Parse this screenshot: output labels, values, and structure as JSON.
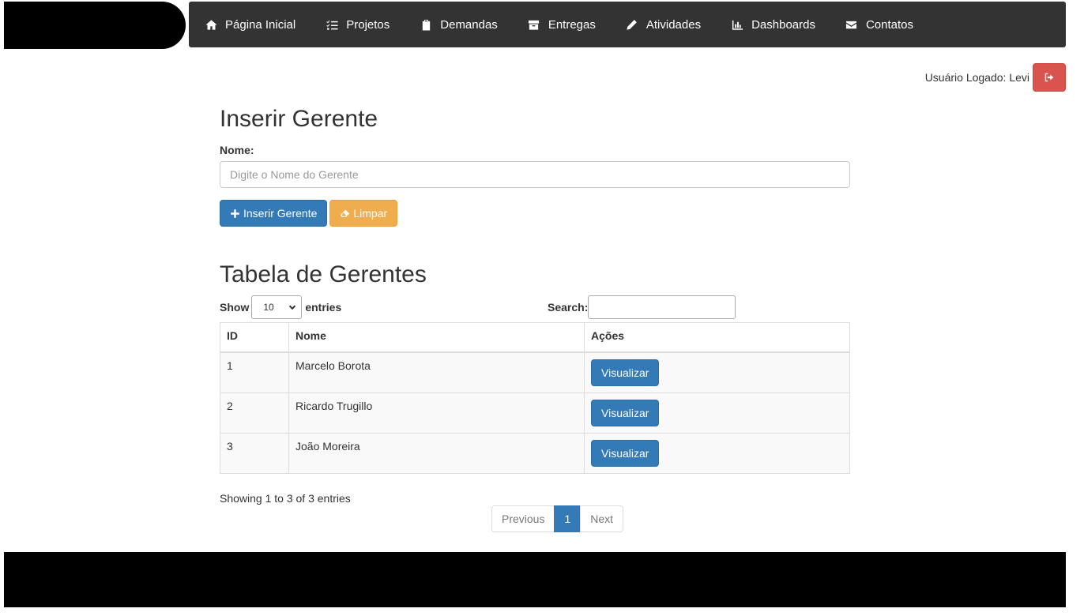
{
  "nav": {
    "items": [
      {
        "label": "Página Inicial",
        "icon": "home-icon"
      },
      {
        "label": "Projetos",
        "icon": "tasks-icon"
      },
      {
        "label": "Demandas",
        "icon": "clipboard-icon"
      },
      {
        "label": "Entregas",
        "icon": "package-icon"
      },
      {
        "label": "Atividades",
        "icon": "pencil-icon"
      },
      {
        "label": "Dashboards",
        "icon": "bar-chart-icon"
      },
      {
        "label": "Contatos",
        "icon": "envelope-icon"
      }
    ]
  },
  "user": {
    "label": "Usuário Logado: Levi",
    "logout_icon": "sign-out-icon"
  },
  "form": {
    "title": "Inserir Gerente",
    "name_label": "Nome:",
    "name_placeholder": "Digite o Nome do Gerente",
    "name_value": "",
    "insert_label": "Inserir Gerente",
    "clear_label": "Limpar"
  },
  "table": {
    "title": "Tabela de Gerentes",
    "show_label": "Show",
    "length_value": "10",
    "entries_label": "entries",
    "search_label": "Search:",
    "search_value": "",
    "columns": [
      "ID",
      "Nome",
      "Ações"
    ],
    "rows": [
      {
        "id": "1",
        "nome": "Marcelo Borota",
        "action": "Visualizar"
      },
      {
        "id": "2",
        "nome": "Ricardo Trugillo",
        "action": "Visualizar"
      },
      {
        "id": "3",
        "nome": "João Moreira",
        "action": "Visualizar"
      }
    ],
    "info": "Showing 1 to 3 of 3 entries",
    "pagination": {
      "previous": "Previous",
      "current": "1",
      "next": "Next"
    }
  },
  "colors": {
    "navbar": "#333333",
    "primary": "#337ab7",
    "warning": "#f0ad4e",
    "danger": "#d9534f"
  }
}
